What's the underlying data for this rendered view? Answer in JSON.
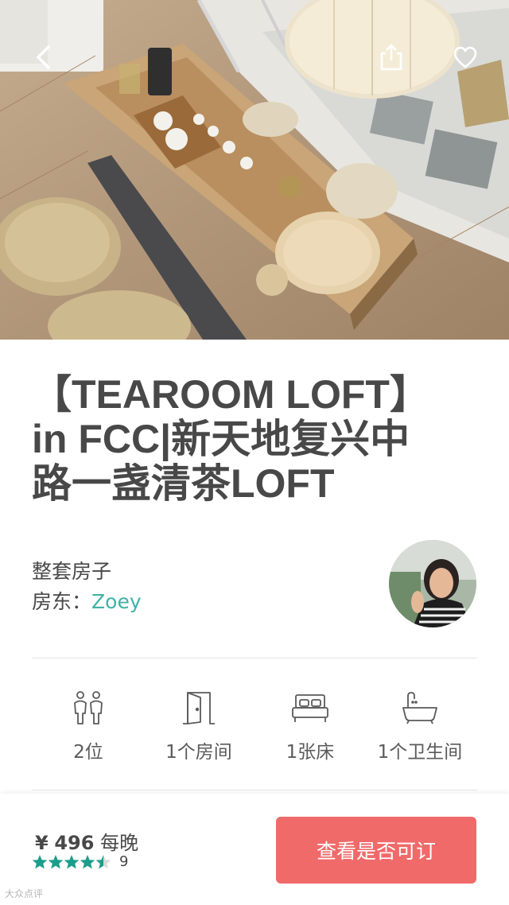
{
  "listing": {
    "title_line1": "【TEAROOM LOFT】",
    "title_line2": "in FCC|新天地复兴中",
    "title_line3": "路一盏清茶LOFT",
    "room_type": "整套房子",
    "host_label": "房东：",
    "host_name": "Zoey"
  },
  "icons": {
    "back": "chevron-left-icon",
    "share": "share-icon",
    "favorite": "heart-outline-icon",
    "guests": "people-icon",
    "rooms": "door-icon",
    "beds": "bed-icon",
    "bathrooms": "bathtub-icon",
    "rating": "star-icon"
  },
  "amenities": {
    "guests": "2位",
    "bedrooms": "1个房间",
    "beds": "1张床",
    "bathrooms": "1个卫生间"
  },
  "booking": {
    "currency": "¥",
    "price": "496",
    "per_night": "每晚",
    "rating_stars": 4.5,
    "review_count": "9",
    "button_label": "查看是否可订"
  },
  "watermark": "大众点评",
  "colors": {
    "accent_teal": "#3fb2a6",
    "rating_green": "#1b9e8a",
    "button_coral": "#f06a6a",
    "text_dark": "#484848",
    "divider": "#e4e4e4"
  }
}
